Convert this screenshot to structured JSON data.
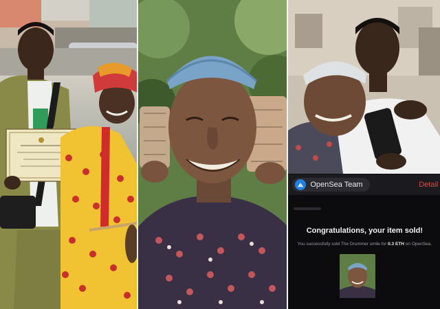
{
  "screenshot": {
    "sender_name": "OpenSea Team",
    "details_link": "Detail",
    "headline": "Congratulations, your item sold!",
    "message_prefix": "You successfully sold The Drummer smile for",
    "price": "0.3 ETH",
    "message_suffix": "on OpenSea."
  },
  "colors": {
    "app_background": "#0c0c0e",
    "accent_link": "#e0493d",
    "opensea_blue": "#2081e2"
  },
  "icons": [
    "opensea-logo-icon"
  ]
}
